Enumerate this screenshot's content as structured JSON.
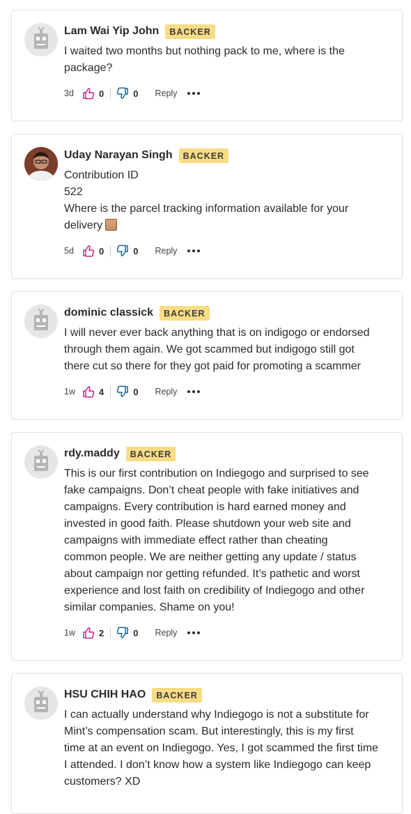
{
  "comments": [
    {
      "author": "Lam Wai Yip John",
      "badge": "BACKER",
      "avatar": "robot-avatar",
      "lines": [
        "I waited two months but nothing pack to me, where is the",
        "package?"
      ],
      "age": "3d",
      "likes": "0",
      "dislikes": "0",
      "reply": "Reply"
    },
    {
      "author": "Uday Narayan Singh",
      "badge": "BACKER",
      "avatar": "photo-avatar",
      "lines": [
        "Contribution ID",
        "522",
        "Where is the parcel tracking information available for your",
        "delivery"
      ],
      "age": "5d",
      "likes": "0",
      "dislikes": "0",
      "reply": "Reply"
    },
    {
      "author": "dominic classick",
      "badge": "BACKER",
      "avatar": "robot-avatar",
      "lines": [
        "I will never ever back anything that is on indigogo or endorsed",
        "through them again. We got scammed but indigogo still got",
        "there cut so there for they got paid for promoting a scammer"
      ],
      "age": "1w",
      "likes": "4",
      "dislikes": "0",
      "reply": "Reply"
    },
    {
      "author": "rdy.maddy",
      "badge": "BACKER",
      "avatar": "robot-avatar",
      "lines": [
        "This is our first contribution on Indiegogo and surprised to see",
        "fake campaigns. Don’t cheat people with fake initiatives and",
        "campaigns. Every contribution is hard earned money and",
        "invested in good faith. Please shutdown your web site and",
        "campaigns with immediate effect rather than cheating",
        "common people. We are neither getting any update / status",
        "about campaign nor getting refunded. It’s pathetic and worst",
        "experience and lost faith on credibility of Indiegogo and other",
        "similar companies. Shame on you!"
      ],
      "age": "1w",
      "likes": "2",
      "dislikes": "0",
      "reply": "Reply"
    },
    {
      "author": "HSU CHIH HAO",
      "badge": "BACKER",
      "avatar": "robot-avatar",
      "lines": [
        "I can actually understand why Indiegogo is not a substitute for",
        "Mint’s compensation scam. But interestingly, this is my first",
        "time at an event on Indiegogo. Yes, I got scammed the first time",
        "I attended. I don’t know how a system like Indiegogo can keep",
        "customers? XD"
      ]
    }
  ],
  "colors": {
    "like": "#c5197d",
    "dislike": "#0b5d8f",
    "badge": "#f9dc84"
  }
}
